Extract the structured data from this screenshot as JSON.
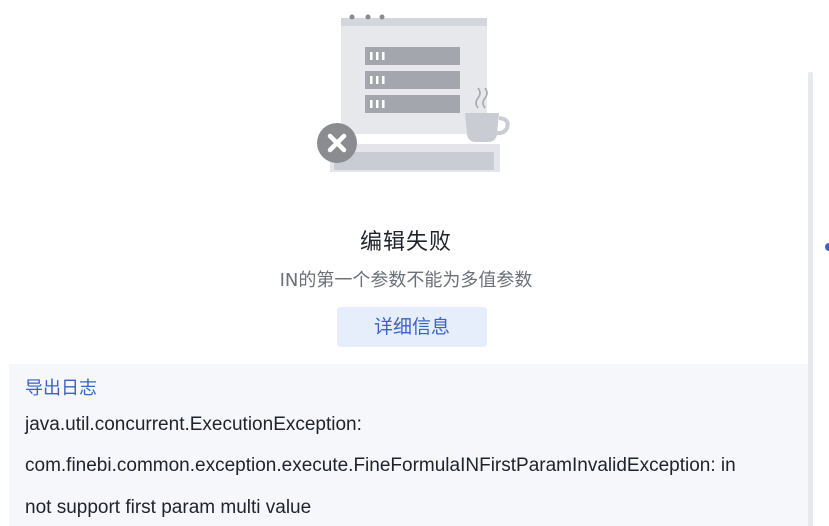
{
  "dialog": {
    "title": "编辑失败",
    "message": "IN的第一个参数不能为多值参数",
    "details_button": "详细信息"
  },
  "log": {
    "export_link": "导出日志",
    "lines": [
      "java.util.concurrent.ExecutionException:",
      "com.finebi.common.exception.execute.FineFormulaINFirstParamInvalidException: in",
      "not support first param multi value"
    ]
  },
  "icons": {
    "illustration": "server-rack-coffee-illustration",
    "error_badge": "close-circle-icon"
  },
  "colors": {
    "accent": "#3a62c9",
    "button_bg": "#e6eefb",
    "panel_bg": "#f5f7fb",
    "error_badge": "#8a8c90"
  }
}
